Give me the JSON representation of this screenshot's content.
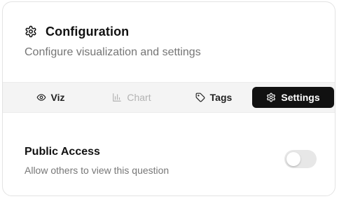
{
  "header": {
    "title": "Configuration",
    "subtitle": "Configure visualization and settings",
    "icon": "gear-icon"
  },
  "tabs": [
    {
      "label": "Viz",
      "icon": "eye-icon",
      "state": "enabled"
    },
    {
      "label": "Chart",
      "icon": "bar-chart-icon",
      "state": "disabled"
    },
    {
      "label": "Tags",
      "icon": "tag-icon",
      "state": "enabled"
    },
    {
      "label": "Settings",
      "icon": "gear-icon",
      "state": "active"
    }
  ],
  "settings": {
    "public_access": {
      "title": "Public Access",
      "description": "Allow others to view this question",
      "enabled": false
    }
  },
  "colors": {
    "active_tab_bg": "#111111",
    "tabbar_bg": "#f4f4f4",
    "toggle_off": "#e7e7e7"
  }
}
